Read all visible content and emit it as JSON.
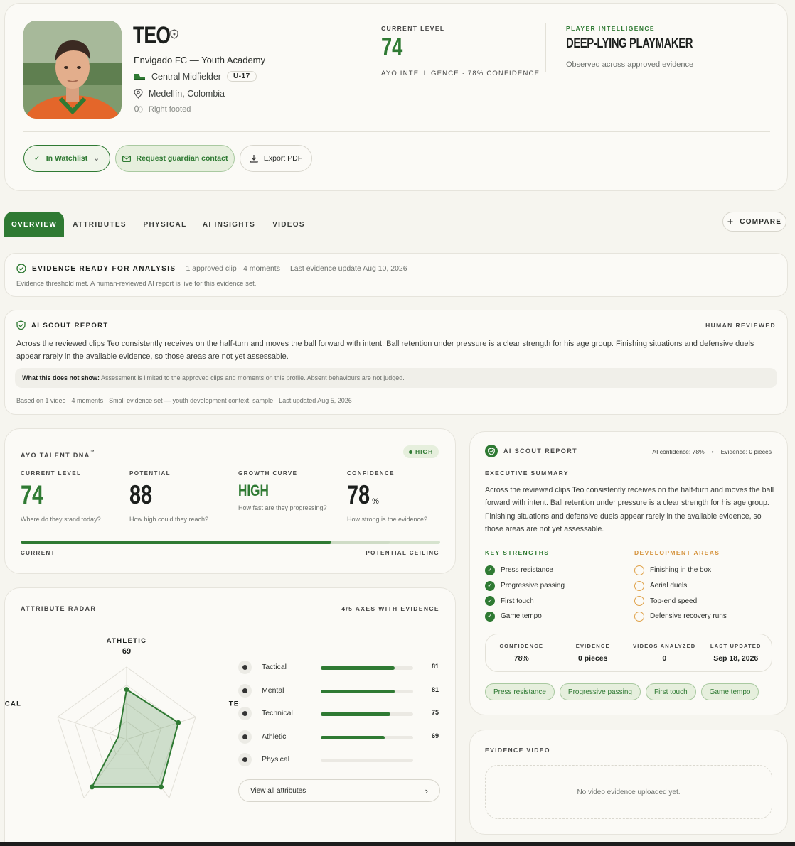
{
  "player": {
    "name": "TEO",
    "club": "Envigado FC — Youth Academy",
    "position": "Central Midfielder",
    "age_group": "U-17",
    "location": "Medellín, Colombia",
    "foot": "Right footed"
  },
  "header_stats": {
    "current_level_label": "CURRENT LEVEL",
    "current_level": "74",
    "confidence_line": "AYO INTELLIGENCE · 78% CONFIDENCE",
    "intel_label": "PLAYER INTELLIGENCE",
    "intel_role": "DEEP-LYING PLAYMAKER",
    "intel_note": "Observed across approved evidence"
  },
  "actions": {
    "watchlist": "In Watchlist",
    "guardian": "Request guardian contact",
    "export": "Export PDF"
  },
  "tabs": [
    "OVERVIEW",
    "ATTRIBUTES",
    "PHYSICAL",
    "AI INSIGHTS",
    "VIDEOS"
  ],
  "compare": "COMPARE",
  "evidence_banner": {
    "title": "EVIDENCE READY FOR ANALYSIS",
    "clips": "1 approved clip · 4 moments",
    "last_update": "Last evidence update Aug 10, 2026",
    "note": "Evidence threshold met. A human-reviewed AI report is live for this evidence set."
  },
  "scout_report_top": {
    "title": "AI SCOUT REPORT",
    "badge": "HUMAN REVIEWED",
    "body": "Across the reviewed clips Teo consistently receives on the half-turn and moves the ball forward with intent. Ball retention under pressure is a clear strength for his age group. Finishing situations and defensive duels appear rarely in the available evidence, so those areas are not yet assessable.",
    "disclaimer_label": "What this does not show:",
    "disclaimer": "Assessment is limited to the approved clips and moments on this profile. Absent behaviours are not judged.",
    "footer": "Based on 1 video · 4 moments · Small evidence set — youth development context. sample · Last updated Aug 5, 2026"
  },
  "talent_dna": {
    "title": "AYO TALENT DNA",
    "tm": "™",
    "badge": "HIGH",
    "metrics": [
      {
        "label": "CURRENT LEVEL",
        "value": "74",
        "unit": "",
        "caption": "Where do they stand today?"
      },
      {
        "label": "POTENTIAL",
        "value": "88",
        "unit": "",
        "caption": "How high could they reach?"
      },
      {
        "label": "GROWTH CURVE",
        "value": "HIGH",
        "unit": "",
        "caption": "How fast are they progressing?"
      },
      {
        "label": "CONFIDENCE",
        "value": "78",
        "unit": "%",
        "caption": "How strong is the evidence?"
      }
    ],
    "progress_current": 74,
    "progress_potential": 88,
    "bar_left": "CURRENT",
    "bar_right": "POTENTIAL CEILING"
  },
  "radar": {
    "title": "ATTRIBUTE RADAR",
    "evidence": "4/5 AXES WITH EVIDENCE",
    "axes": [
      {
        "name": "ATHLETIC",
        "value": "69",
        "score": 69
      },
      {
        "name": "TECHNICAL",
        "value": "75",
        "score": 75
      },
      {
        "name": "TACTICAL",
        "value": "81",
        "score": 81
      },
      {
        "name": "MENTAL",
        "value": "81",
        "score": 81
      },
      {
        "name": "PHYSICAL",
        "value": "—",
        "score": 0
      }
    ],
    "list": [
      {
        "name": "Tactical",
        "value": "81",
        "score": 81
      },
      {
        "name": "Mental",
        "value": "81",
        "score": 81
      },
      {
        "name": "Technical",
        "value": "75",
        "score": 75
      },
      {
        "name": "Athletic",
        "value": "69",
        "score": 69
      },
      {
        "name": "Physical",
        "value": "—",
        "score": 0
      }
    ],
    "view_all": "View all attributes"
  },
  "scout_report_side": {
    "title": "AI SCOUT REPORT",
    "ai_confidence": "AI confidence: 78%",
    "evidence_count": "Evidence: 0 pieces",
    "summary_label": "EXECUTIVE SUMMARY",
    "summary": "Across the reviewed clips Teo consistently receives on the half-turn and moves the ball forward with intent. Ball retention under pressure is a clear strength for his age group. Finishing situations and defensive duels appear rarely in the available evidence, so those areas are not yet assessable.",
    "strengths_label": "KEY STRENGTHS",
    "strengths": [
      "Press resistance",
      "Progressive passing",
      "First touch",
      "Game tempo"
    ],
    "dev_label": "DEVELOPMENT AREAS",
    "dev": [
      "Finishing in the box",
      "Aerial duels",
      "Top-end speed",
      "Defensive recovery runs"
    ],
    "stats": [
      {
        "label": "CONFIDENCE",
        "value": "78%"
      },
      {
        "label": "EVIDENCE",
        "value": "0 pieces"
      },
      {
        "label": "VIDEOS ANALYZED",
        "value": "0"
      },
      {
        "label": "LAST UPDATED",
        "value": "Sep 18, 2026"
      }
    ],
    "chips": [
      "Press resistance",
      "Progressive passing",
      "First touch",
      "Game tempo"
    ]
  },
  "evidence_video": {
    "title": "EVIDENCE VIDEO",
    "empty": "No video evidence uploaded yet."
  },
  "colors": {
    "accent": "#2f7a33",
    "dev": "#e0a24a",
    "background": "#f6f5ef"
  }
}
